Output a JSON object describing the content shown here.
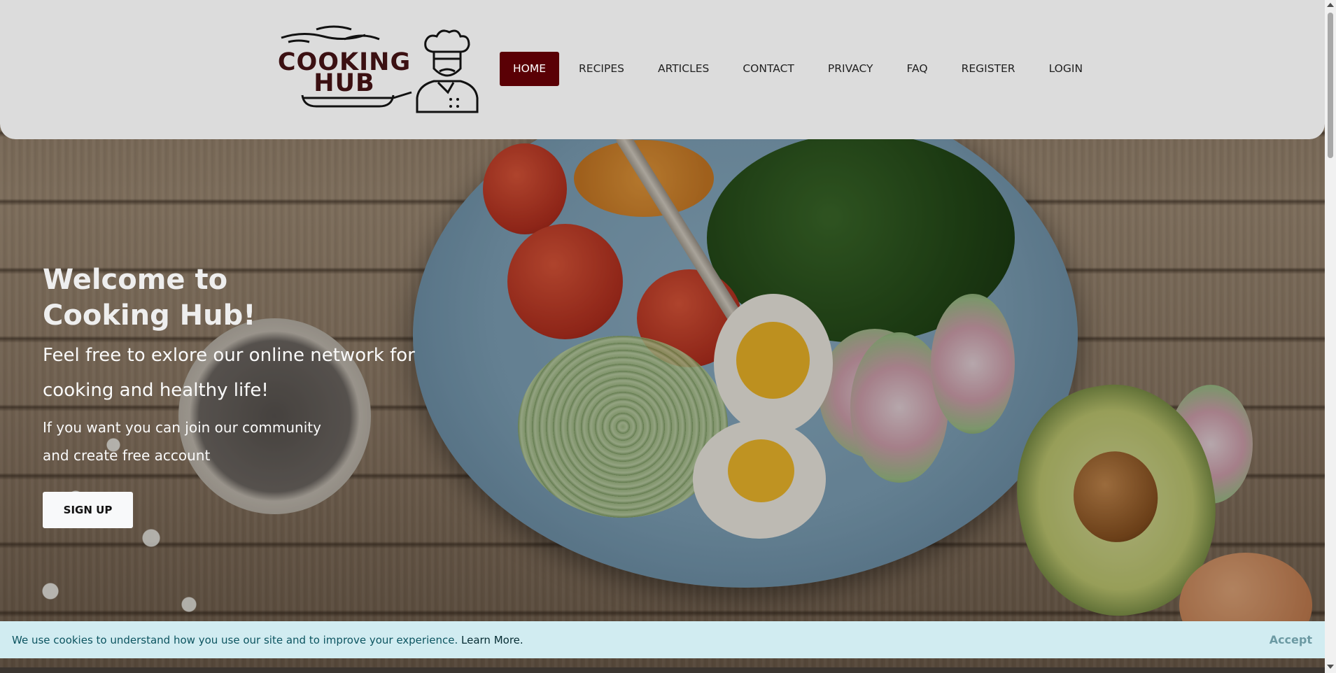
{
  "brand": {
    "logo_line1": "COOKING",
    "logo_line2": "HUB"
  },
  "nav": {
    "items": [
      {
        "label": "HOME",
        "active": true
      },
      {
        "label": "RECIPES"
      },
      {
        "label": "ARTICLES"
      },
      {
        "label": "CONTACT"
      },
      {
        "label": "PRIVACY"
      },
      {
        "label": "FAQ"
      },
      {
        "label": "REGISTER"
      },
      {
        "label": "LOGIN"
      }
    ]
  },
  "hero": {
    "title": "Welcome to Cooking Hub!",
    "subtitle": "Feel free to exlore our online network for cooking and healthy life!",
    "text": "If you want you can join our community and create free account",
    "signup_label": "SIGN UP"
  },
  "cookie": {
    "message": "We use cookies to understand how you use our site and to improve your experience.",
    "link_label": "Learn More.",
    "accept_label": "Accept"
  },
  "colors": {
    "header_bg": "#dcdcdc",
    "nav_active_bg": "#5a0005",
    "logo_color": "#3b1012",
    "cookie_bg": "#d1ecf1",
    "cookie_text": "#0c5460"
  }
}
